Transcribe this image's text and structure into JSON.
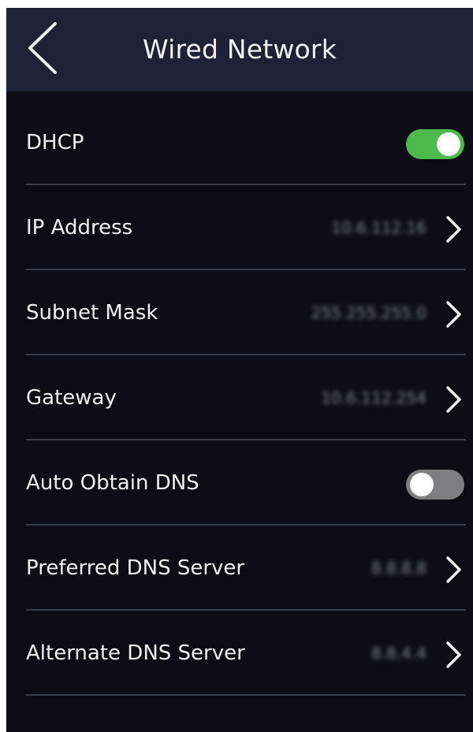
{
  "header": {
    "title": "Wired Network",
    "back_icon": "chevron-left-icon"
  },
  "settings": [
    {
      "id": "dhcp",
      "label": "DHCP",
      "type": "toggle",
      "enabled": true
    },
    {
      "id": "ip-address",
      "label": "IP Address",
      "type": "link",
      "value": "10.6.112.16"
    },
    {
      "id": "subnet-mask",
      "label": "Subnet Mask",
      "type": "link",
      "value": "255.255.255.0"
    },
    {
      "id": "gateway",
      "label": "Gateway",
      "type": "link",
      "value": "10.6.112.254"
    },
    {
      "id": "auto-obtain-dns",
      "label": "Auto Obtain DNS",
      "type": "toggle",
      "enabled": false
    },
    {
      "id": "preferred-dns",
      "label": "Preferred DNS Server",
      "type": "link",
      "value": "8.8.8.8"
    },
    {
      "id": "alternate-dns",
      "label": "Alternate DNS Server",
      "type": "link",
      "value": "8.8.4.4"
    }
  ],
  "colors": {
    "background": "#0d0c17",
    "header": "#1f2237",
    "toggle_on": "#4cbb4c",
    "toggle_off": "#7d7d82",
    "divider": "#3a3b49"
  }
}
